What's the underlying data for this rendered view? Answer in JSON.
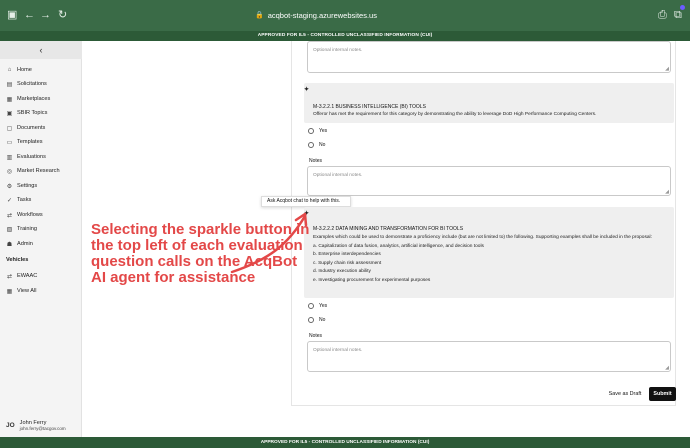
{
  "browser": {
    "url": "acqbot-staging.azurewebsites.us",
    "icons": [
      "sidebar-toggle-icon",
      "back-icon",
      "forward-icon",
      "reload-icon",
      "lock-icon",
      "share-icon",
      "tabs-icon"
    ]
  },
  "banner": {
    "top": "APPROVED FOR IL5 - CONTROLLED UNCLASSIFIED INFORMATION (CUI)",
    "bottom": "APPROVED FOR IL5 - CONTROLLED UNCLASSIFIED INFORMATION (CUI)"
  },
  "sidebar": {
    "collapse_glyph": "‹",
    "items": [
      {
        "label": "Home",
        "icon": "⌂",
        "icon_name": "home-icon"
      },
      {
        "label": "Solicitations",
        "icon": "▤",
        "icon_name": "document-icon"
      },
      {
        "label": "Marketplaces",
        "icon": "▦",
        "icon_name": "marketplace-icon"
      },
      {
        "label": "SBIR Topics",
        "icon": "▣",
        "icon_name": "topics-icon"
      },
      {
        "label": "Documents",
        "icon": "▢",
        "icon_name": "documents-icon"
      },
      {
        "label": "Templates",
        "icon": "▭",
        "icon_name": "templates-icon"
      },
      {
        "label": "Evaluations",
        "icon": "▥",
        "icon_name": "evaluations-icon"
      },
      {
        "label": "Market Research",
        "icon": "◎",
        "icon_name": "globe-icon"
      },
      {
        "label": "Settings",
        "icon": "⚙",
        "icon_name": "gear-icon"
      },
      {
        "label": "Tasks",
        "icon": "✓",
        "icon_name": "tasks-icon"
      },
      {
        "label": "Workflows",
        "icon": "⇄",
        "icon_name": "workflows-icon"
      },
      {
        "label": "Training",
        "icon": "▧",
        "icon_name": "training-icon"
      },
      {
        "label": "Admin",
        "icon": "☗",
        "icon_name": "admin-icon"
      }
    ],
    "vehicles_label": "Vehicles",
    "vehicles": [
      {
        "label": "EWAAC",
        "icon": "⇄",
        "icon_name": "vehicle-icon"
      },
      {
        "label": "View All",
        "icon": "▦",
        "icon_name": "view-all-icon"
      }
    ],
    "user": {
      "initials": "JO",
      "name": "John Ferry",
      "email": "john.ferry@tacgov.com"
    }
  },
  "form": {
    "notes_placeholder": "Optional internal notes.",
    "sparkle_glyph": "✦",
    "q1": {
      "title": "M-3.2.2.1 BUSINESS INTELLIGENCE (BI) TOOLS",
      "text": "Offeror has met the requirement for this category by demonstrating the ability to leverage DoD High Performance Computing Centers.",
      "yes": "Yes",
      "no": "No",
      "notes_label": "Notes"
    },
    "tooltip": "Ask Acqbot chat to help with this.",
    "q2": {
      "title": "M-3.2.2.2 DATA MINING AND TRANSFORMATION FOR BI TOOLS",
      "intro": "Examples which could be used to demonstrate a proficiency include (but are not limited to) the following.  Supporting examples shall be included in the proposal:",
      "items": [
        "a. Capitalization of data fusion, analytics, artificial intelligence, and decision tools",
        "b. Enterprise interdependencies",
        "c. Supply chain risk assessment",
        "d. Industry execution ability",
        "e. Investigating procurement for experimental purposes"
      ],
      "yes": "Yes",
      "no": "No",
      "notes_label": "Notes"
    },
    "save_draft": "Save as Draft",
    "submit": "Submit"
  },
  "annotation": {
    "text": "Selecting the sparkle button in the top left of each evaluation question calls on the AcqBot AI agent for assistance",
    "color": "#e34848"
  }
}
